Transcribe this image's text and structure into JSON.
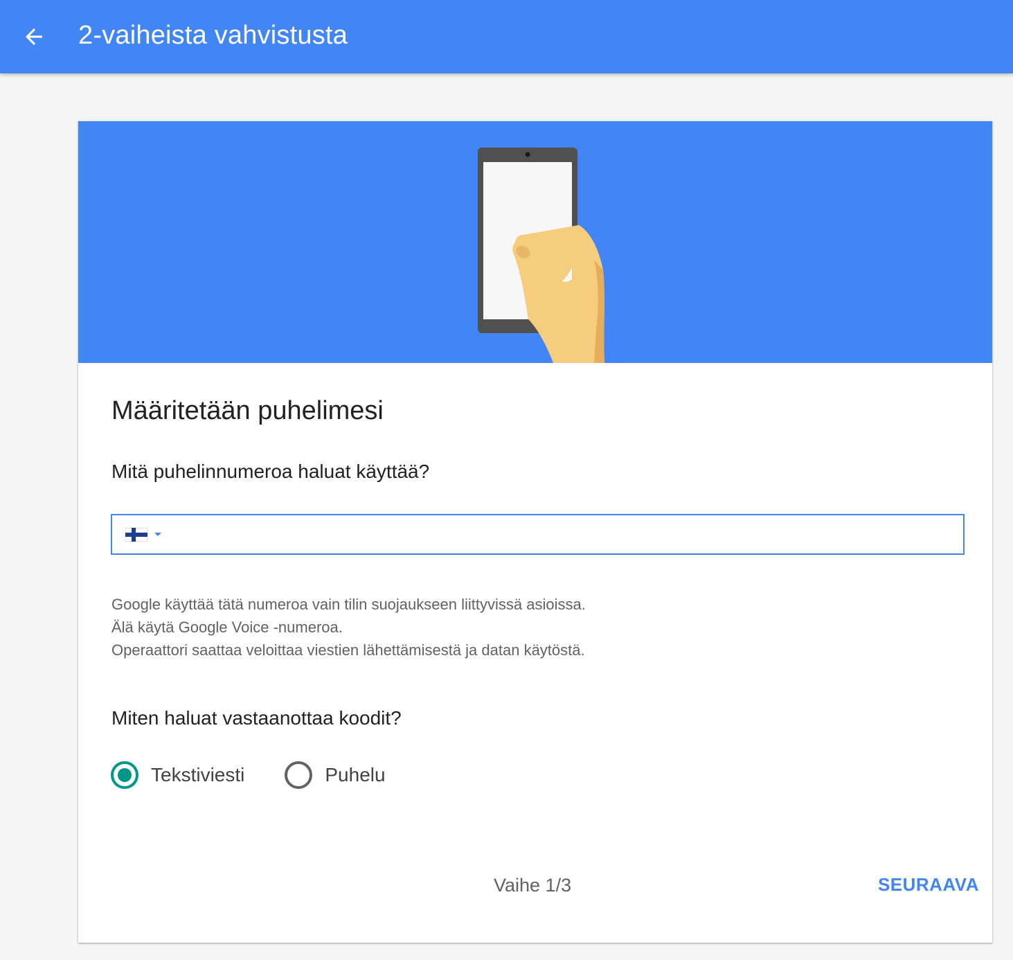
{
  "header": {
    "back_icon": "arrow-back-icon",
    "title": "2-vaiheista vahvistusta"
  },
  "hero": {
    "illustration": "hand-holding-phone-illustration"
  },
  "card": {
    "title": "Määritetään puhelimesi",
    "phone_question": "Mitä puhelinnumeroa haluat käyttää?",
    "phone_input": {
      "country_flag": "finland-flag-icon",
      "dropdown_icon": "caret-down-icon",
      "value": "",
      "placeholder": ""
    },
    "notes": [
      "Google käyttää tätä numeroa vain tilin suojaukseen liittyvissä asioissa.",
      "Älä käytä Google Voice -numeroa.",
      "Operaattori saattaa veloittaa viestien lähettämisestä ja datan käytöstä."
    ],
    "delivery_question": "Miten haluat vastaanottaa koodit?",
    "delivery_options": [
      {
        "label": "Tekstiviesti",
        "selected": true
      },
      {
        "label": "Puhelu",
        "selected": false
      }
    ],
    "step": "Vaihe 1/3",
    "next_label": "SEURAAVA"
  },
  "colors": {
    "primary": "#4285f4",
    "radio_selected": "#009688",
    "background": "#f5f5f5",
    "card": "#ffffff"
  }
}
